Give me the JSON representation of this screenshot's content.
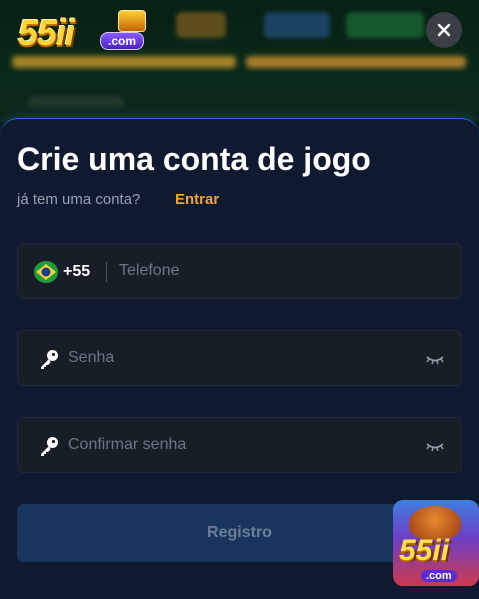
{
  "brand": {
    "logo_digits": "55ii",
    "logo_suffix": ".com"
  },
  "modal": {
    "title": "Crie uma conta de jogo",
    "subtitle": "já tem uma conta?",
    "login_link": "Entrar",
    "phone": {
      "country_code": "+55",
      "placeholder": "Telefone",
      "value": "",
      "flag": "brazil-flag"
    },
    "password": {
      "placeholder": "Senha",
      "value": ""
    },
    "confirm_password": {
      "placeholder": "Confirmar senha",
      "value": ""
    },
    "register_label": "Registro"
  },
  "promo": {
    "digits": "55ii",
    "suffix": ".com"
  },
  "icons": {
    "close": "close-icon",
    "key": "key-icon",
    "eye_closed": "eye-closed-icon"
  },
  "colors": {
    "accent": "#f2a43a",
    "modal_bg": "#0f1a30",
    "field_bg": "#181e28",
    "button_bg": "#19355e"
  }
}
